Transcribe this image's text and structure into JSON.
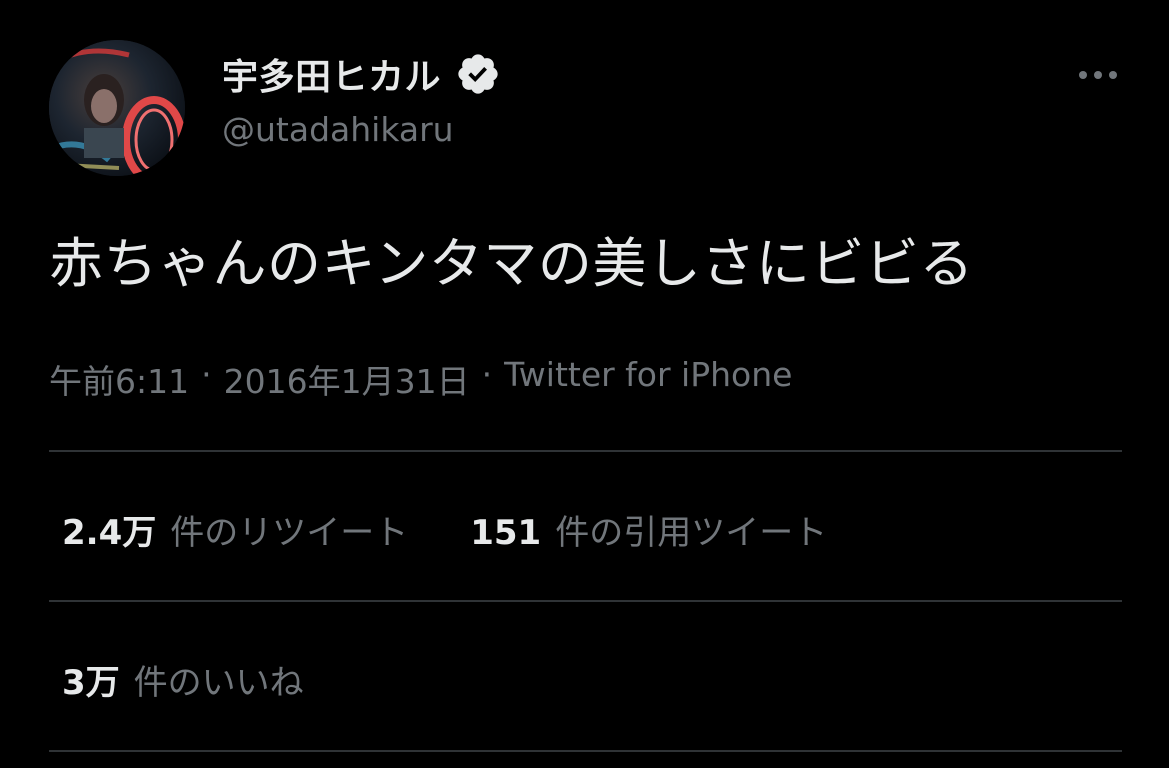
{
  "user": {
    "display_name": "宇多田ヒカル",
    "handle": "@utadahikaru",
    "verified": true
  },
  "tweet": {
    "text": "赤ちゃんのキンタマの美しさにビビる",
    "time": "午前6:11",
    "date": "2016年1月31日",
    "source": "Twitter for iPhone",
    "separator": "·"
  },
  "stats": {
    "retweets_count": "2.4万",
    "retweets_label": "件のリツイート",
    "quotes_count": "151",
    "quotes_label": "件の引用ツイート",
    "likes_count": "3万",
    "likes_label": "件のいいね"
  },
  "colors": {
    "background": "#000000",
    "primary_text": "#e7e9ea",
    "secondary_text": "#71767b",
    "divider": "#2f3336",
    "verified_badge": "#e7e9ea"
  },
  "icons": {
    "verified": "verified-badge-icon",
    "more": "more-horizontal-icon"
  }
}
